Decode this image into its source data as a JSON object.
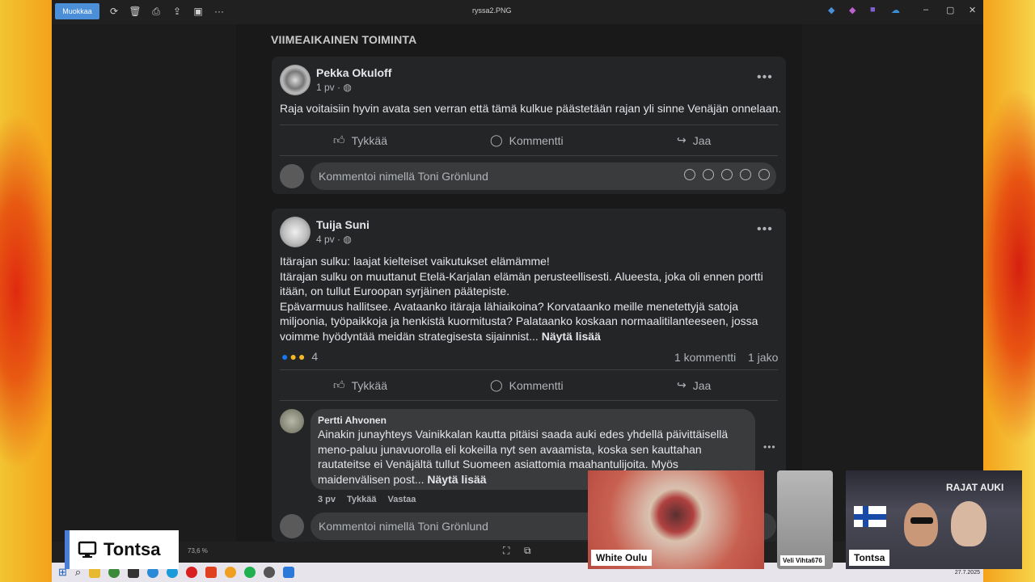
{
  "viewer": {
    "edit_label": "Muokkaa",
    "file_title": "ryssa2.PNG",
    "zoom": "73,6 %"
  },
  "section_title": "VIIMEAIKAINEN TOIMINTA",
  "post1": {
    "author": "Pekka Okuloff",
    "time": "1 pv · ",
    "text": "Raja voitaisiin hyvin avata sen verran että tämä kulkue päästetään rajan yli sinne Venäjän onnelaan.",
    "like": "Tykkää",
    "comment": "Kommentti",
    "share": "Jaa",
    "comment_placeholder": "Kommentoi nimellä Toni Grönlund"
  },
  "post2": {
    "author": "Tuija Suni",
    "time": "4 pv · ",
    "lines": [
      "Itärajan sulku: laajat kielteiset vaikutukset elämämme!",
      "Itärajan sulku on muuttanut Etelä-Karjalan elämän perusteellisesti. Alueesta, joka oli ennen portti",
      "itään, on tullut Euroopan syrjäinen päätepiste.",
      "Epävarmuus hallitsee. Avataanko itäraja lähiaikoina? Korvataanko meille menetettyjä satoja",
      "miljoonia, työpaikkoja ja henkistä kuormitusta? Palataanko koskaan normaalitilanteeseen, jossa",
      "voimme hyödyntää meidän strategisesta sijainnist... "
    ],
    "see_more": "Näytä lisää",
    "reaction_count": "4",
    "comments_count": "1 kommentti",
    "shares_count": "1 jako",
    "like": "Tykkää",
    "comment": "Kommentti",
    "share": "Jaa",
    "comment_placeholder": "Kommentoi nimellä Toni Grönlund"
  },
  "reply": {
    "author": "Pertti Ahvonen",
    "lines": [
      "Ainakin junayhteys Vainikkalan kautta pitäisi saada auki edes yhdellä päivittäisellä",
      "meno-paluu junavuorolla eli kokeilla nyt sen avaamista, koska sen kauttahan",
      "rautateitse ei Venäjältä tullut Suomeen asiattomia maahantulijoita. Myös",
      "maidenvälisen post... "
    ],
    "see_more": "Näytä lisää",
    "time": "3 pv",
    "like": "Tykkää",
    "reply": "Vastaa"
  },
  "webcams": {
    "tile1": "White Oulu",
    "tile2": "Veli Vihta676",
    "tile3": "Tontsa",
    "tile3_sign": "RAJAT AUKI"
  },
  "badge": {
    "label": "Tontsa"
  },
  "taskbar": {
    "date": "27.7.2025"
  },
  "colors": {
    "facebook_dark_card": "#242526",
    "text_primary": "#e4e6eb",
    "text_secondary": "#b0b3b8",
    "accent_blue": "#4a8fd8"
  }
}
